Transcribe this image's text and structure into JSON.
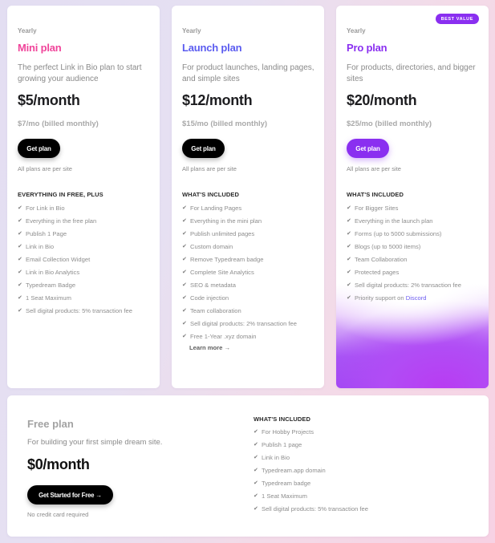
{
  "plans": {
    "mini": {
      "period": "Yearly",
      "name": "Mini plan",
      "name_color": "#f0449a",
      "description": "The perfect Link in Bio plan to start growing your audience",
      "price": "$5/month",
      "monthly_price": "$7/mo (billed monthly)",
      "cta": "Get plan",
      "note": "All plans are per site",
      "features_heading": "EVERYTHING IN FREE, PLUS",
      "features": [
        "For Link in Bio",
        "Everything in the free plan",
        "Publish 1 Page",
        "Link in Bio",
        "Email Collection Widget",
        "Link in Bio Analytics",
        "Typedream Badge",
        "1 Seat Maximum",
        "Sell digital products: 5% transaction fee"
      ]
    },
    "launch": {
      "period": "Yearly",
      "name": "Launch plan",
      "name_color": "#5b5cf0",
      "description": "For product launches, landing pages, and simple sites",
      "price": "$12/month",
      "monthly_price": "$15/mo (billed monthly)",
      "cta": "Get plan",
      "note": "All plans are per site",
      "features_heading": "WHAT'S INCLUDED",
      "features": [
        "For Landing Pages",
        "Everything in the mini plan",
        "Publish unlimited pages",
        "Custom domain",
        "Remove Typedream badge",
        "Complete Site Analytics",
        "SEO & metadata",
        "Code injection",
        "Team collaboration",
        "Sell digital products: 2% transaction fee",
        "Free 1-Year .xyz domain"
      ],
      "learn_more": "Learn more →"
    },
    "pro": {
      "badge": "BEST VALUE",
      "period": "Yearly",
      "name": "Pro plan",
      "name_color": "#8a2ff0",
      "description": "For products, directories, and bigger sites",
      "price": "$20/month",
      "monthly_price": "$25/mo (billed monthly)",
      "cta": "Get plan",
      "note": "All plans are per site",
      "features_heading": "WHAT'S INCLUDED",
      "features": [
        "For Bigger Sites",
        "Everything in the launch plan",
        "Forms (up to 5000 submissions)",
        "Blogs (up to 5000 items)",
        "Team Collaboration",
        "Protected pages",
        "Sell digital products: 2% transaction fee"
      ],
      "last_feature_prefix": "Priority support on ",
      "last_feature_link": "Discord"
    },
    "free": {
      "name": "Free plan",
      "description": "For building your first simple dream site.",
      "price": "$0/month",
      "cta": "Get Started for Free →",
      "note": "No credit card required",
      "features_heading": "WHAT'S INCLUDED",
      "features": [
        "For Hobby Projects",
        "Publish 1 page",
        "Link in Bio",
        "Typedream.app domain",
        "Typedream badge",
        "1 Seat Maximum",
        "Sell digital products: 5% transaction fee"
      ]
    }
  },
  "icons": {
    "check": "✔"
  }
}
